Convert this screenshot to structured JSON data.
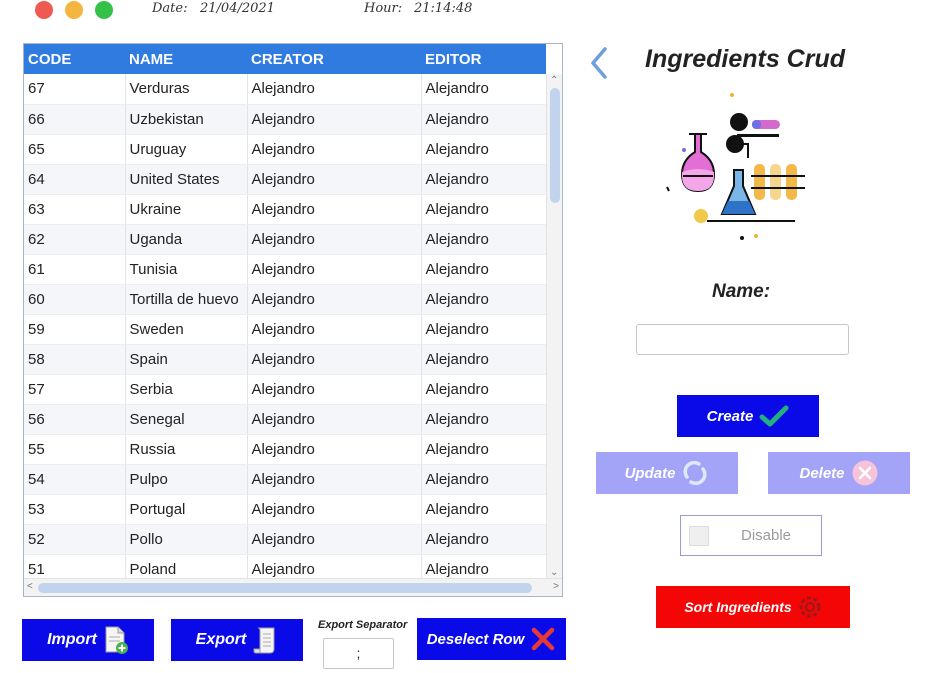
{
  "header": {
    "date_label": "Date:",
    "date_value": "21/04/2021",
    "hour_label": "Hour:",
    "hour_value": "21:14:48"
  },
  "table": {
    "columns": [
      "CODE",
      "NAME",
      "CREATOR",
      "EDITOR"
    ],
    "rows": [
      [
        "67",
        "Verduras",
        "Alejandro",
        "Alejandro"
      ],
      [
        "66",
        "Uzbekistan",
        "Alejandro",
        "Alejandro"
      ],
      [
        "65",
        "Uruguay",
        "Alejandro",
        "Alejandro"
      ],
      [
        "64",
        "United States",
        "Alejandro",
        "Alejandro"
      ],
      [
        "63",
        "Ukraine",
        "Alejandro",
        "Alejandro"
      ],
      [
        "62",
        "Uganda",
        "Alejandro",
        "Alejandro"
      ],
      [
        "61",
        "Tunisia",
        "Alejandro",
        "Alejandro"
      ],
      [
        "60",
        "Tortilla de huevo",
        "Alejandro",
        "Alejandro"
      ],
      [
        "59",
        "Sweden",
        "Alejandro",
        "Alejandro"
      ],
      [
        "58",
        "Spain",
        "Alejandro",
        "Alejandro"
      ],
      [
        "57",
        "Serbia",
        "Alejandro",
        "Alejandro"
      ],
      [
        "56",
        "Senegal",
        "Alejandro",
        "Alejandro"
      ],
      [
        "55",
        "Russia",
        "Alejandro",
        "Alejandro"
      ],
      [
        "54",
        "Pulpo",
        "Alejandro",
        "Alejandro"
      ],
      [
        "53",
        "Portugal",
        "Alejandro",
        "Alejandro"
      ],
      [
        "52",
        "Pollo",
        "Alejandro",
        "Alejandro"
      ],
      [
        "51",
        "Poland",
        "Alejandro",
        "Alejandro"
      ]
    ]
  },
  "panel": {
    "title": "Ingredients Crud",
    "name_label": "Name:",
    "name_value": "",
    "create_label": "Create",
    "update_label": "Update",
    "delete_label": "Delete",
    "disable_label": "Disable",
    "sort_label": "Sort Ingredients"
  },
  "bottom": {
    "import_label": "Import",
    "export_label": "Export",
    "separator_label": "Export Separator",
    "separator_value": ";",
    "deselect_label": "Deselect Row"
  },
  "icons": {
    "back": "chevron-left-icon",
    "create": "checkmark-icon",
    "update": "refresh-icon",
    "delete": "close-circle-icon",
    "sort": "gear-icon",
    "import": "file-add-icon",
    "export": "scroll-document-icon",
    "deselect": "x-icon"
  },
  "colors": {
    "header_blue": "#2f7be0",
    "primary_button": "#0a0ae8",
    "disabled_button": "#a3a3f7",
    "sort_button": "#f40606"
  }
}
